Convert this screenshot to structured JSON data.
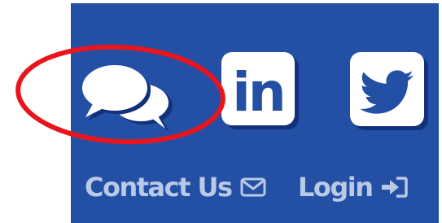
{
  "social": {
    "chat_icon": "chat-bubbles-icon",
    "linkedin_icon": "linkedin-icon",
    "linkedin_text": "in",
    "twitter_icon": "twitter-bird-icon"
  },
  "links": {
    "contact_label": "Contact Us",
    "contact_icon": "envelope-icon",
    "login_label": "Login",
    "login_icon": "sign-in-icon"
  },
  "colors": {
    "panel_background": "#2350a5",
    "link_text": "#b9c9e6",
    "icon_fill": "#ffffff",
    "annotation_ellipse": "#e8161c"
  }
}
